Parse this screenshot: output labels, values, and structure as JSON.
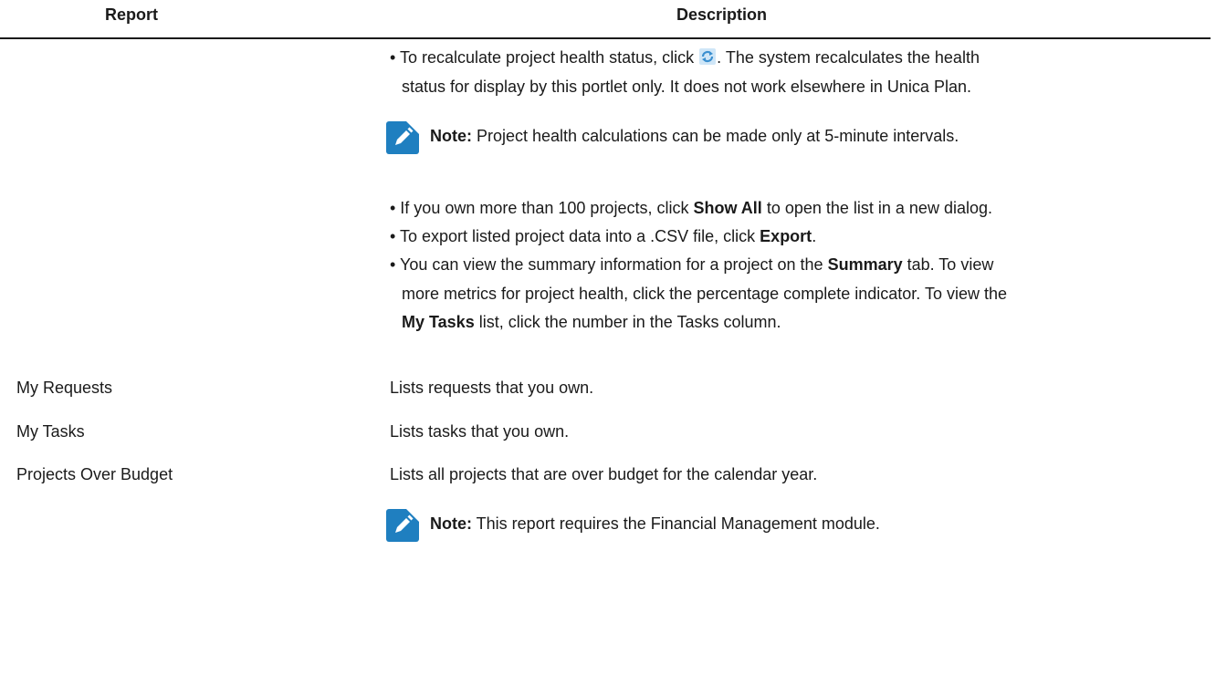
{
  "table": {
    "headers": {
      "report": "Report",
      "description": "Description"
    }
  },
  "continued": {
    "recalc": {
      "pre": "• To recalculate project health status, click ",
      "post": ". The system recalculates the health",
      "line2": "status for display by this portlet only. It does not work elsewhere in Unica Plan.",
      "icon": "refresh-icon"
    },
    "note1": {
      "label": "Note:",
      "text": " Project health calculations can be made only at 5-minute intervals."
    },
    "showall": {
      "pre": "• If you own more than 100 projects, click ",
      "bold": "Show All",
      "post": " to open the list in a new dialog."
    },
    "export": {
      "pre": "• To export listed project data into a .CSV file, click ",
      "bold": "Export",
      "post": "."
    },
    "summary": {
      "l1_pre": "• You can view the summary information for a project on the ",
      "l1_bold": "Summary",
      "l1_post": " tab. To view",
      "l2": "more metrics for project health, click the percentage complete indicator. To view the",
      "l3_bold": "My Tasks",
      "l3_post": " list, click the number in the Tasks column."
    }
  },
  "rows": [
    {
      "name": "My Requests",
      "description": "Lists requests that you own."
    },
    {
      "name": "My Tasks",
      "description": "Lists tasks that you own."
    },
    {
      "name": "Projects Over Budget",
      "description": "Lists all projects that are over budget for the calendar year."
    }
  ],
  "note2": {
    "label": "Note:",
    "text": " This report requires the Financial Management module."
  },
  "colors": {
    "note_icon_bg": "#1f7fc0",
    "refresh_icon": "#4da3d9",
    "text": "#1a1a1a"
  }
}
